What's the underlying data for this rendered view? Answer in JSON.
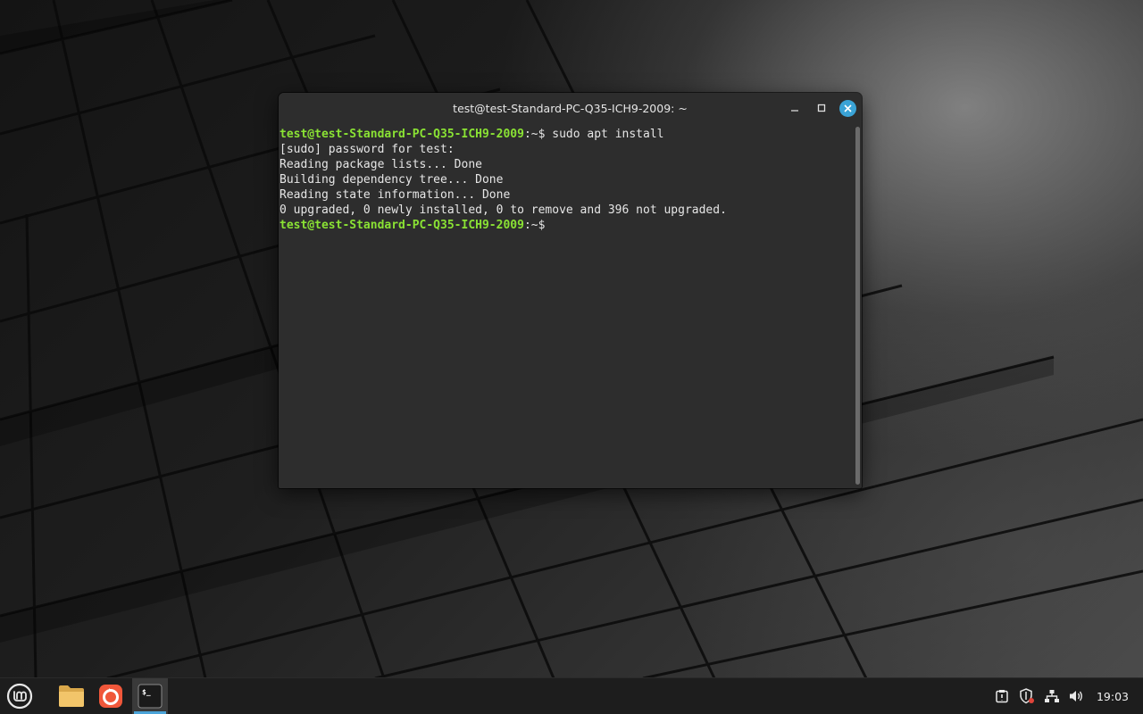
{
  "window": {
    "title": "test@test-Standard-PC-Q35-ICH9-2009: ~"
  },
  "terminal": {
    "lines": [
      {
        "user_host": "test@test-Standard-PC-Q35-ICH9-2009",
        "path_prompt": ":~$ ",
        "command": "sudo apt install"
      },
      {
        "text": "[sudo] password for test: "
      },
      {
        "text": "Reading package lists... Done"
      },
      {
        "text": "Building dependency tree... Done"
      },
      {
        "text": "Reading state information... Done"
      },
      {
        "text": "0 upgraded, 0 newly installed, 0 to remove and 396 not upgraded."
      },
      {
        "user_host": "test@test-Standard-PC-Q35-ICH9-2009",
        "path_prompt": ":~$ ",
        "command": ""
      }
    ]
  },
  "taskbar": {
    "launchers": [
      {
        "name": "menu",
        "icon": "linux-mint-logo-icon"
      },
      {
        "name": "files",
        "icon": "folder-icon"
      },
      {
        "name": "firefox-like-browser",
        "icon": "browser-icon"
      },
      {
        "name": "terminal",
        "icon": "terminal-icon",
        "active": true
      }
    ],
    "tray": {
      "icons": [
        "clipboard-icon",
        "shield-update-icon",
        "network-icon",
        "volume-icon"
      ],
      "clock": "19:03"
    }
  },
  "colors": {
    "prompt_green": "#8ae234",
    "accent_blue": "#3aa3d6",
    "terminal_bg": "#2d2d2d"
  }
}
